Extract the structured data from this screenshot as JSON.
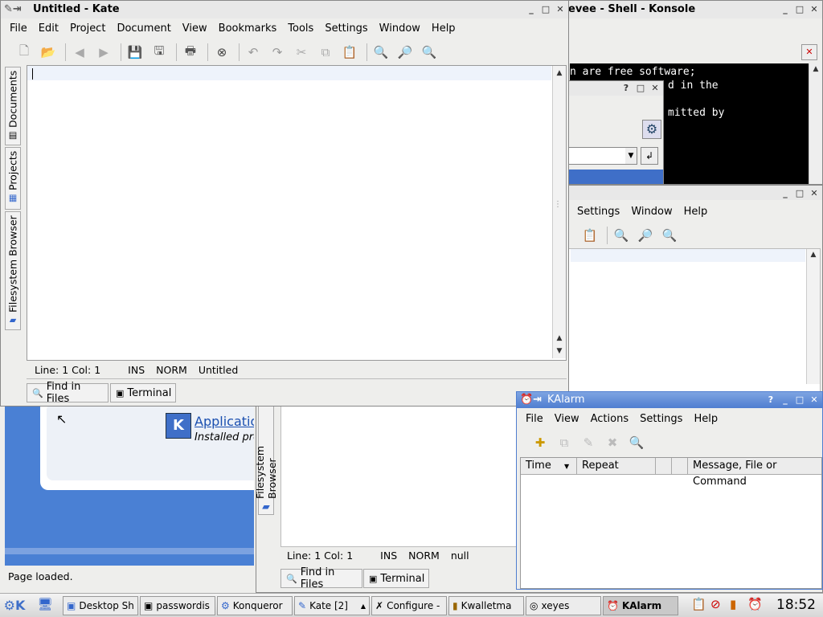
{
  "desktop": {
    "bg": "#4a7fcf"
  },
  "konsole": {
    "title": "evee - Shell - Konsole",
    "lines": [
      "n are free software;",
      "d in the",
      "",
      "mitted by"
    ]
  },
  "konsole_dialog": {},
  "kate_back": {
    "menus": [
      "Settings",
      "Window",
      "Help"
    ],
    "status": {
      "pos": "Line: 1 Col: 1",
      "mode": "INS",
      "norm": "NORM",
      "file": "null"
    },
    "tabs": {
      "find": "Find in Files",
      "terminal": "Terminal"
    },
    "sidetab": "Filesystem Browser"
  },
  "konqueror": {
    "link": "Applicatio",
    "sub": "Installed pro",
    "status": "Page loaded."
  },
  "kate": {
    "title": "Untitled - Kate",
    "menus": [
      "File",
      "Edit",
      "Project",
      "Document",
      "View",
      "Bookmarks",
      "Tools",
      "Settings",
      "Window",
      "Help"
    ],
    "sidetabs": {
      "documents": "Documents",
      "projects": "Projects",
      "filesystem": "Filesystem Browser"
    },
    "status": {
      "pos": "Line: 1 Col: 1",
      "mode": "INS",
      "norm": "NORM",
      "file": "Untitled"
    },
    "tabs": {
      "find": "Find in Files",
      "terminal": "Terminal"
    }
  },
  "kalarm": {
    "title": "KAlarm",
    "menus": [
      "File",
      "View",
      "Actions",
      "Settings",
      "Help"
    ],
    "columns": {
      "time": "Time",
      "repeat": "Repeat",
      "message": "Message, File or Command"
    }
  },
  "taskbar": {
    "items": [
      "Desktop Sh",
      "passwordis",
      "Konqueror",
      "Kate [2]",
      "Configure - ",
      "Kwalletma",
      "xeyes",
      "KAlarm"
    ],
    "clock": "18:52"
  }
}
